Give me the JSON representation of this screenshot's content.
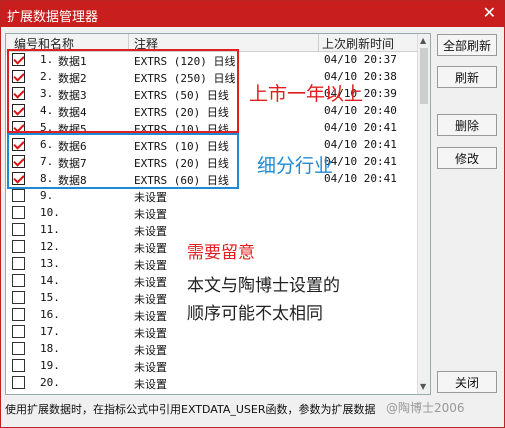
{
  "window": {
    "title": "扩展数据管理器",
    "close_glyph": "✕"
  },
  "table": {
    "headers": {
      "name": "编号和名称",
      "note": "注释",
      "time": "上次刷新时间"
    },
    "rows": [
      {
        "checked": true,
        "num": "1.",
        "name": "数据1",
        "note": "EXTRS (120) 日线",
        "time": "04/10 20:37"
      },
      {
        "checked": true,
        "num": "2.",
        "name": "数据2",
        "note": "EXTRS (250) 日线",
        "time": "04/10 20:38"
      },
      {
        "checked": true,
        "num": "3.",
        "name": "数据3",
        "note": "EXTRS (50) 日线",
        "time": "04/10 20:39"
      },
      {
        "checked": true,
        "num": "4.",
        "name": "数据4",
        "note": "EXTRS (20) 日线",
        "time": "04/10 20:40"
      },
      {
        "checked": true,
        "num": "5.",
        "name": "数据5",
        "note": "EXTRS (10) 日线",
        "time": "04/10 20:41"
      },
      {
        "checked": true,
        "num": "6.",
        "name": "数据6",
        "note": "EXTRS (10) 日线",
        "time": "04/10 20:41"
      },
      {
        "checked": true,
        "num": "7.",
        "name": "数据7",
        "note": "EXTRS (20) 日线",
        "time": "04/10 20:41"
      },
      {
        "checked": true,
        "num": "8.",
        "name": "数据8",
        "note": "EXTRS (60) 日线",
        "time": "04/10 20:41"
      },
      {
        "checked": false,
        "num": "9.",
        "name": "",
        "note": "未设置",
        "time": ""
      },
      {
        "checked": false,
        "num": "10.",
        "name": "",
        "note": "未设置",
        "time": ""
      },
      {
        "checked": false,
        "num": "11.",
        "name": "",
        "note": "未设置",
        "time": ""
      },
      {
        "checked": false,
        "num": "12.",
        "name": "",
        "note": "未设置",
        "time": ""
      },
      {
        "checked": false,
        "num": "13.",
        "name": "",
        "note": "未设置",
        "time": ""
      },
      {
        "checked": false,
        "num": "14.",
        "name": "",
        "note": "未设置",
        "time": ""
      },
      {
        "checked": false,
        "num": "15.",
        "name": "",
        "note": "未设置",
        "time": ""
      },
      {
        "checked": false,
        "num": "16.",
        "name": "",
        "note": "未设置",
        "time": ""
      },
      {
        "checked": false,
        "num": "17.",
        "name": "",
        "note": "未设置",
        "time": ""
      },
      {
        "checked": false,
        "num": "18.",
        "name": "",
        "note": "未设置",
        "time": ""
      },
      {
        "checked": false,
        "num": "19.",
        "name": "",
        "note": "未设置",
        "time": ""
      },
      {
        "checked": false,
        "num": "20.",
        "name": "",
        "note": "未设置",
        "time": ""
      }
    ]
  },
  "buttons": {
    "refresh_all": "全部刷新",
    "refresh": "刷新",
    "delete": "删除",
    "edit": "修改",
    "close": "关闭"
  },
  "annotations": {
    "red_label": "上市一年以上",
    "blue_label": "细分行业",
    "note_title": "需要留意",
    "note_line1": "本文与陶博士设置的",
    "note_line2": "顺序可能不太相同"
  },
  "status": "使用扩展数据时，在指标公式中引用EXTDATA_USER函数，参数为扩展数据",
  "watermark": "@陶博士2006",
  "colors": {
    "titlebar": "#c81e1e",
    "annotation_red": "#e02020",
    "annotation_blue": "#1e8ad6"
  },
  "icons": {
    "check": "red-checkmark",
    "close": "close-icon"
  }
}
